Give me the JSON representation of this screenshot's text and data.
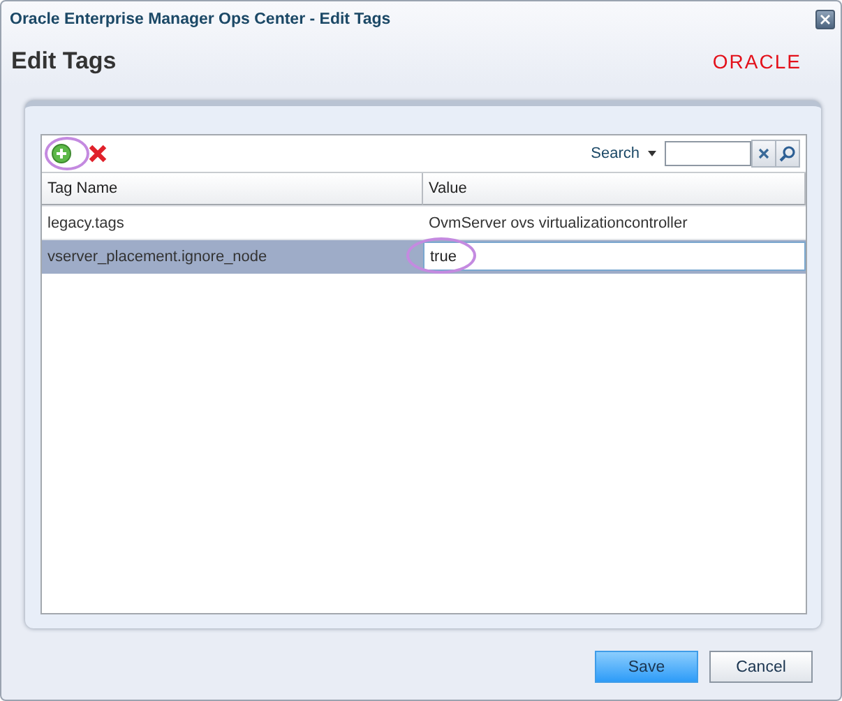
{
  "window": {
    "title": "Oracle Enterprise Manager Ops Center - Edit Tags"
  },
  "heading": "Edit Tags",
  "logo": "ORACLE",
  "toolbar": {
    "search_label": "Search"
  },
  "table": {
    "columns": [
      "Tag Name",
      "Value"
    ],
    "rows": [
      {
        "name": "legacy.tags",
        "value": "OvmServer ovs virtualizationcontroller",
        "selected": false,
        "editing": false
      },
      {
        "name": "vserver_placement.ignore_node",
        "value": "true",
        "selected": true,
        "editing": true
      }
    ]
  },
  "buttons": [
    {
      "label": "Save",
      "primary": true
    },
    {
      "label": "Cancel",
      "primary": false
    }
  ]
}
